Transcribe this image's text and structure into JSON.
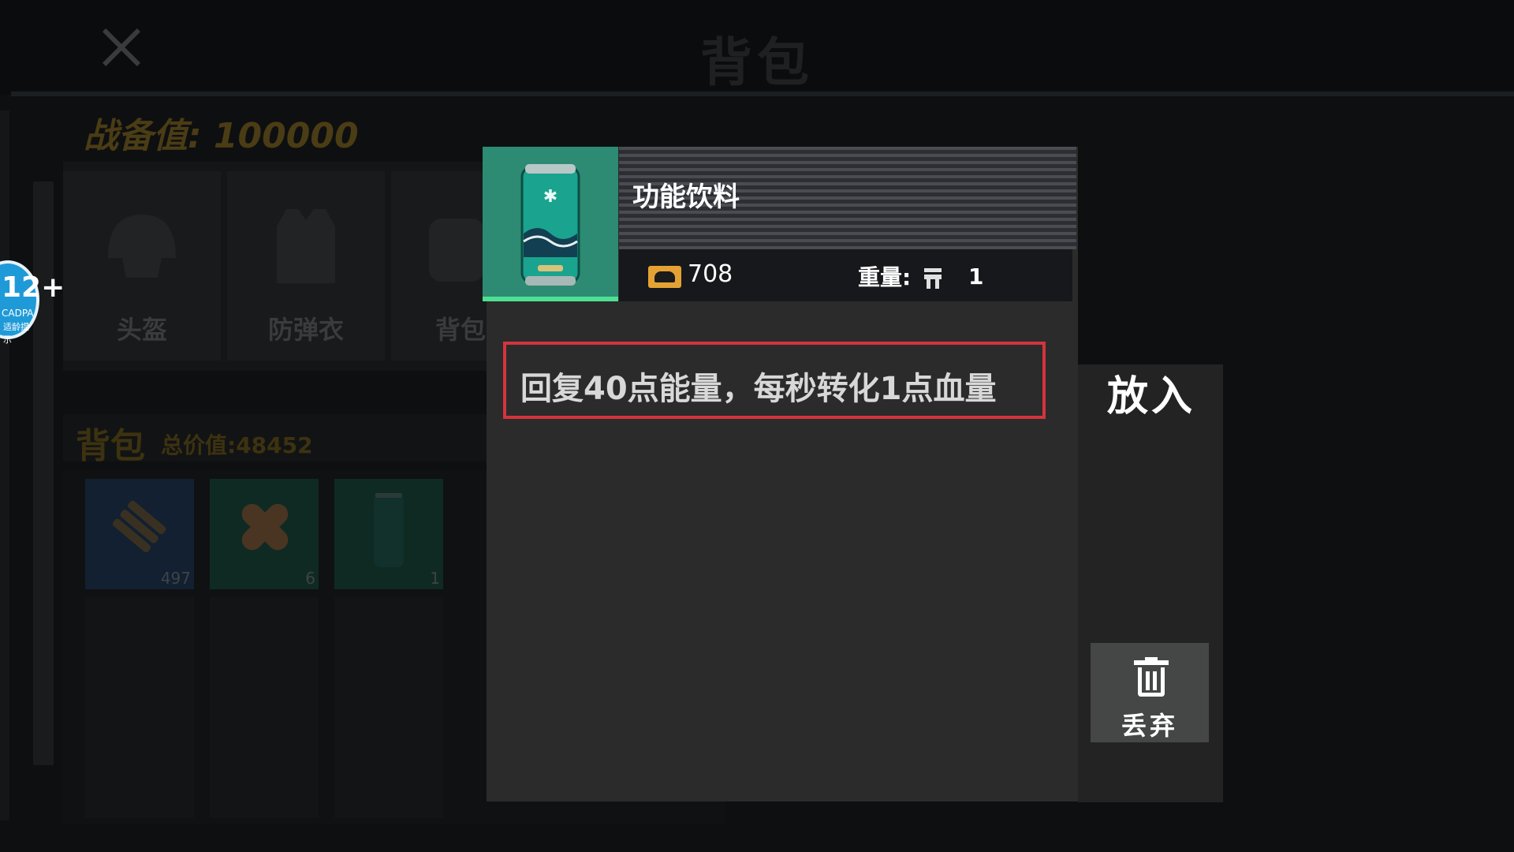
{
  "header": {
    "title": "背包",
    "close_icon": "close-icon"
  },
  "combat": {
    "label": "战备值: 100000"
  },
  "equipment": {
    "slots": [
      {
        "label": "头盔",
        "icon": "helmet-icon"
      },
      {
        "label": "防弹衣",
        "icon": "vest-icon"
      },
      {
        "label": "背包",
        "icon": "backpack-icon"
      }
    ]
  },
  "bag": {
    "title": "背包",
    "total_value": "总价值:48452",
    "items": [
      {
        "name": "ammo",
        "icon": "ammo-icon",
        "qty": "497"
      },
      {
        "name": "bandage",
        "icon": "bandage-icon",
        "qty": "6"
      },
      {
        "name": "energy-drink",
        "icon": "drink-can-icon",
        "qty": "1"
      }
    ]
  },
  "age_badge": {
    "rating": "12+",
    "org": "CADPA",
    "note": "适龄提示"
  },
  "item_detail": {
    "name": "功能饮料",
    "price": "708",
    "weight_label": "重量:",
    "weight_value": "1",
    "description": "回复40点能量，每秒转化1点血量",
    "accent_color": "#2c8b72",
    "highlight_color": "#d4343c"
  },
  "actions": {
    "put_in": "放入",
    "discard": "丢弃"
  }
}
